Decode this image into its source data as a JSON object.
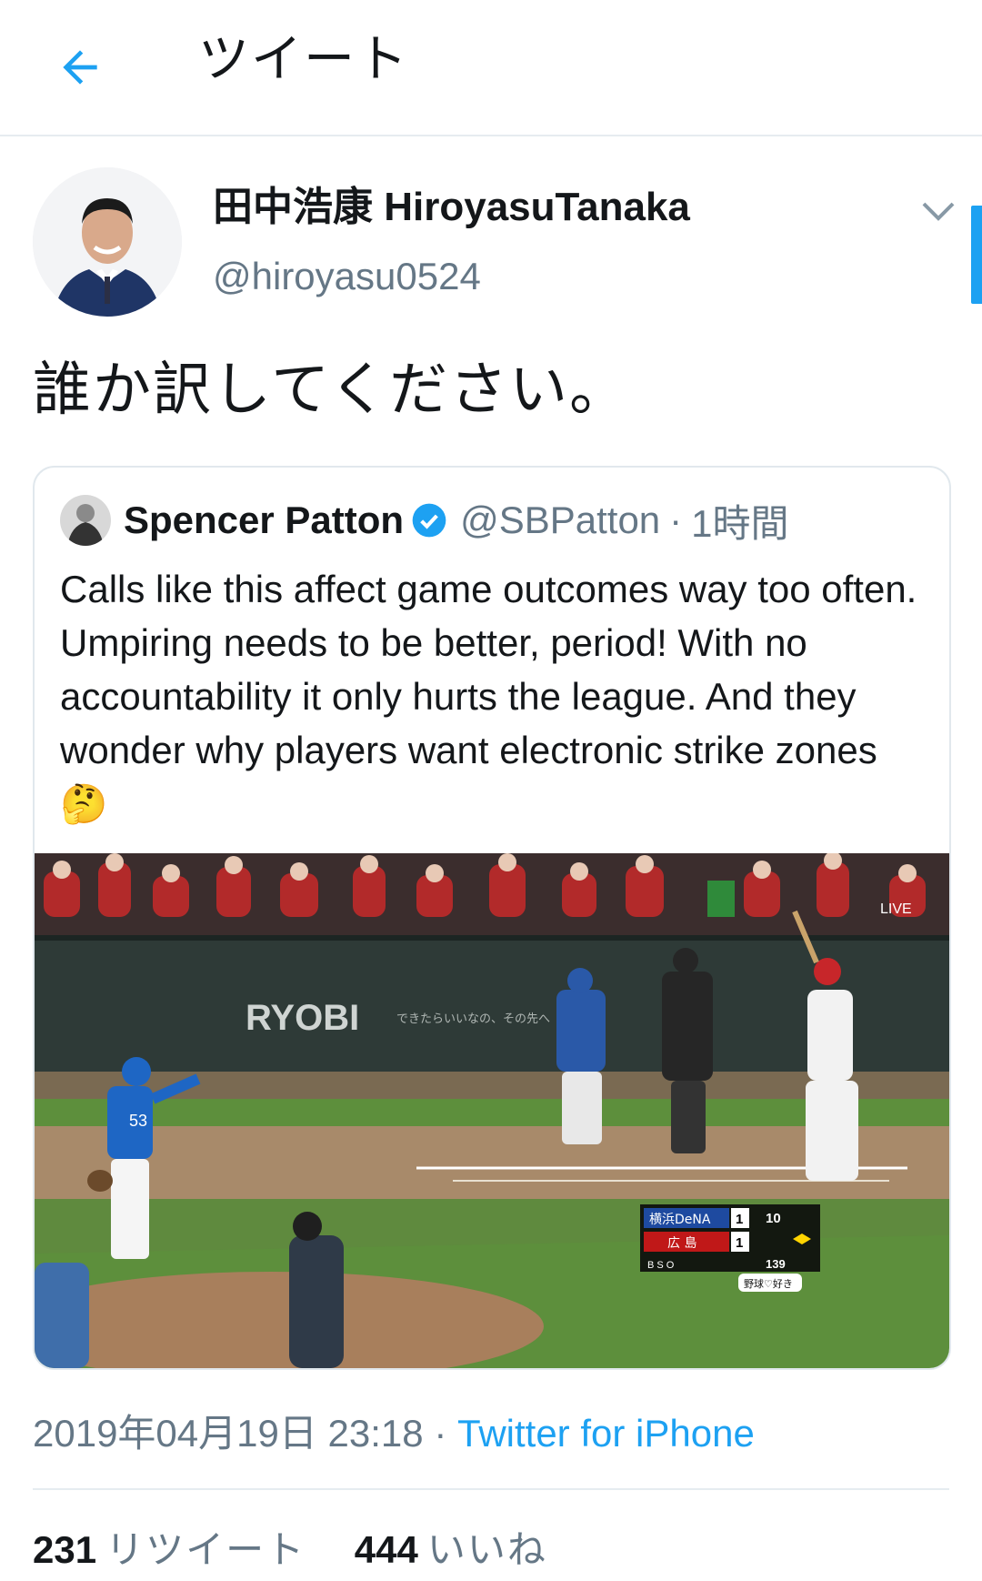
{
  "header": {
    "title": "ツイート",
    "back_icon": "arrow-left-icon"
  },
  "tweet": {
    "author_name": "田中浩康 HiroyasuTanaka",
    "author_handle": "@hiroyasu0524",
    "text": "誰か訳してください。",
    "menu_icon": "chevron-down-icon"
  },
  "quote": {
    "author_name": "Spencer Patton",
    "author_handle": "@SBPatton",
    "separator": "·",
    "time": "1時間",
    "verified_icon": "verified-badge-icon",
    "text": "Calls like this affect game outcomes way too often. Umpiring needs to be better, period! With no accountability it only hurts the league. And they wonder why players want electronic strike zones 🤔",
    "media": {
      "banner_text": "RYOBI",
      "banner_sub": "できたらいいなの、その先へ",
      "live_label": "LIVE",
      "score": {
        "team1": "横浜DeNA",
        "team1_score": "1",
        "team2": "広 島",
        "team2_score": "1",
        "inning": "10",
        "speed": "139",
        "count_label": "B S O",
        "tag": "野球♡好き"
      }
    }
  },
  "meta": {
    "datetime": "2019年04月19日 23:18",
    "separator": "·",
    "source": "Twitter for iPhone"
  },
  "stats": {
    "retweets": "231",
    "retweets_label": "リツイート",
    "likes": "444",
    "likes_label": "いいね"
  },
  "colors": {
    "accent": "#1da1f2",
    "secondary_text": "#657786",
    "border": "#e1e8ed"
  }
}
